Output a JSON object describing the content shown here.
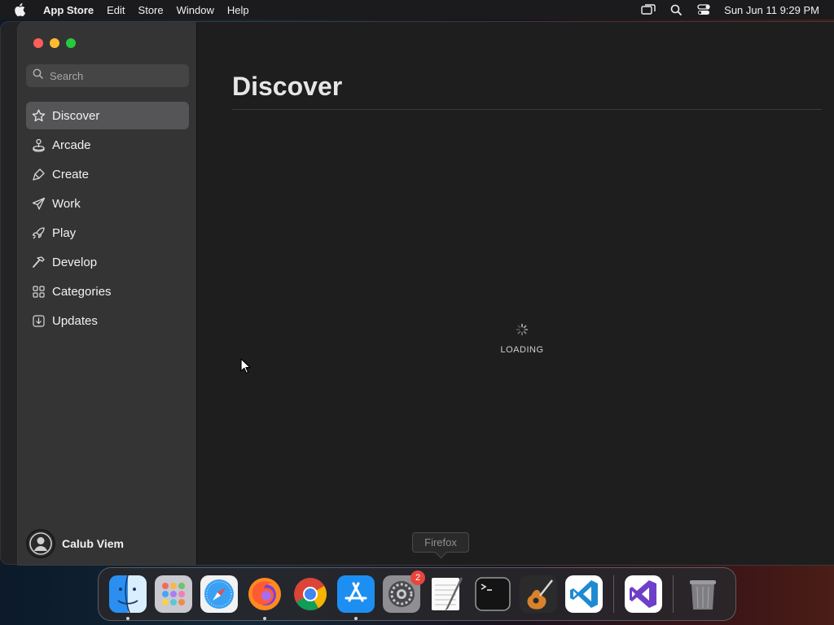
{
  "menubar": {
    "app_name": "App Store",
    "items": [
      "Edit",
      "Store",
      "Window",
      "Help"
    ],
    "clock": "Sun Jun 11  9:29 PM"
  },
  "sidebar": {
    "search_placeholder": "Search",
    "items": [
      {
        "label": "Discover",
        "icon": "star-icon",
        "active": true
      },
      {
        "label": "Arcade",
        "icon": "joystick-icon",
        "active": false
      },
      {
        "label": "Create",
        "icon": "brush-icon",
        "active": false
      },
      {
        "label": "Work",
        "icon": "paper-plane-icon",
        "active": false
      },
      {
        "label": "Play",
        "icon": "rocket-icon",
        "active": false
      },
      {
        "label": "Develop",
        "icon": "hammer-icon",
        "active": false
      },
      {
        "label": "Categories",
        "icon": "grid-icon",
        "active": false
      },
      {
        "label": "Updates",
        "icon": "download-icon",
        "active": false
      }
    ],
    "user_name": "Calub Viem"
  },
  "main": {
    "title": "Discover",
    "loading_label": "LOADING"
  },
  "dock": {
    "tooltip": "Firefox",
    "apps": [
      {
        "name": "Finder",
        "icon": "finder-icon",
        "running": true
      },
      {
        "name": "Launchpad",
        "icon": "launchpad-icon",
        "running": false
      },
      {
        "name": "Safari",
        "icon": "safari-icon",
        "running": false
      },
      {
        "name": "Firefox",
        "icon": "firefox-icon",
        "running": true
      },
      {
        "name": "Chrome",
        "icon": "chrome-icon",
        "running": false
      },
      {
        "name": "App Store",
        "icon": "app-store-icon",
        "running": true
      },
      {
        "name": "System Settings",
        "icon": "system-settings-icon",
        "running": false,
        "badge": "2"
      },
      {
        "name": "TextEdit",
        "icon": "textedit-icon",
        "running": false
      },
      {
        "name": "Terminal",
        "icon": "terminal-icon",
        "running": false
      },
      {
        "name": "GarageBand",
        "icon": "garageband-icon",
        "running": false
      },
      {
        "name": "VS Code",
        "icon": "vscode-icon",
        "running": false
      },
      {
        "name": "Visual Studio",
        "icon": "visual-studio-icon",
        "running": false
      },
      {
        "name": "Trash",
        "icon": "trash-icon",
        "running": false
      }
    ]
  }
}
